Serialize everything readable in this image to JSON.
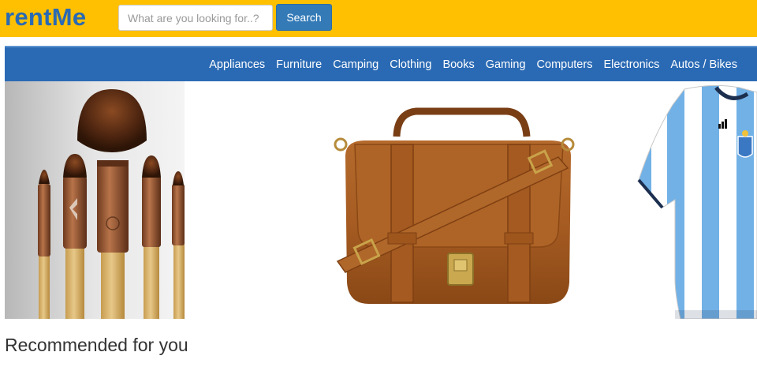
{
  "header": {
    "logo": "rentMe",
    "search": {
      "placeholder": "What are you looking for..?",
      "value": ""
    },
    "search_button_label": "Search"
  },
  "nav": {
    "items": [
      {
        "label": "Appliances"
      },
      {
        "label": "Furniture"
      },
      {
        "label": "Camping"
      },
      {
        "label": "Clothing"
      },
      {
        "label": "Books"
      },
      {
        "label": "Gaming"
      },
      {
        "label": "Computers"
      },
      {
        "label": "Electronics"
      },
      {
        "label": "Autos / Bikes"
      }
    ]
  },
  "carousel": {
    "slides": [
      {
        "icon": "makeup-brushes-image"
      },
      {
        "icon": "leather-satchel-image"
      },
      {
        "icon": "argentina-jersey-image"
      }
    ]
  },
  "main": {
    "section_title": "Recommended for you"
  },
  "colors": {
    "header_bg": "#fec001",
    "logo": "#2a6ab4",
    "nav_bg": "#2a6ab4",
    "button": "#337ab7"
  }
}
